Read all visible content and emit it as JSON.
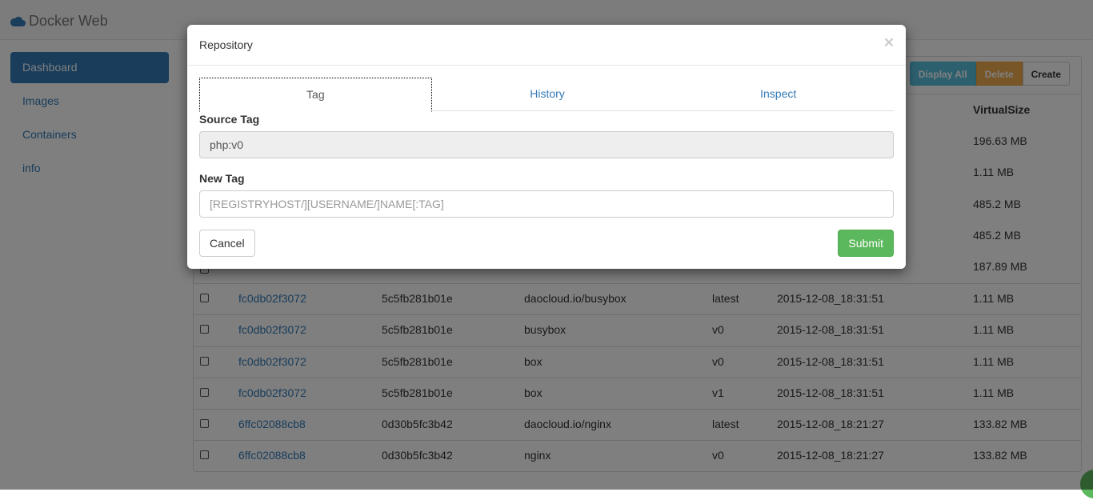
{
  "app": {
    "title": "Docker Web"
  },
  "sidebar": {
    "items": [
      {
        "label": "Dashboard",
        "active": true
      },
      {
        "label": "Images"
      },
      {
        "label": "Containers"
      },
      {
        "label": "info"
      }
    ]
  },
  "toolbar": {
    "display_all": "Display All",
    "delete": "Delete",
    "create": "Create"
  },
  "table": {
    "size_header": "VirtualSize",
    "upper_sizes": [
      "196.63 MB",
      "1.11 MB",
      "485.2 MB",
      "485.2 MB",
      "187.89 MB"
    ],
    "rows": [
      {
        "id": "fc0db02f3072",
        "parent": "5c5fb281b01e",
        "repo": "daocloud.io/busybox",
        "tag": "latest",
        "created": "2015-12-08_18:31:51",
        "size": "1.11 MB"
      },
      {
        "id": "fc0db02f3072",
        "parent": "5c5fb281b01e",
        "repo": "busybox",
        "tag": "v0",
        "created": "2015-12-08_18:31:51",
        "size": "1.11 MB"
      },
      {
        "id": "fc0db02f3072",
        "parent": "5c5fb281b01e",
        "repo": "box",
        "tag": "v0",
        "created": "2015-12-08_18:31:51",
        "size": "1.11 MB"
      },
      {
        "id": "fc0db02f3072",
        "parent": "5c5fb281b01e",
        "repo": "box",
        "tag": "v1",
        "created": "2015-12-08_18:31:51",
        "size": "1.11 MB"
      },
      {
        "id": "6ffc02088cb8",
        "parent": "0d30b5fc3b42",
        "repo": "daocloud.io/nginx",
        "tag": "latest",
        "created": "2015-12-08_18:21:27",
        "size": "133.82 MB"
      },
      {
        "id": "6ffc02088cb8",
        "parent": "0d30b5fc3b42",
        "repo": "nginx",
        "tag": "v0",
        "created": "2015-12-08_18:21:27",
        "size": "133.82 MB"
      }
    ]
  },
  "modal": {
    "title": "Repository",
    "close": "×",
    "tabs": [
      {
        "label": "Tag",
        "active": true
      },
      {
        "label": "History"
      },
      {
        "label": "Inspect"
      }
    ],
    "source_label": "Source Tag",
    "source_value": "php:v0",
    "new_label": "New Tag",
    "new_placeholder": "[REGISTRYHOST/][USERNAME/]NAME[:TAG]",
    "cancel": "Cancel",
    "submit": "Submit"
  },
  "colors": {
    "primary": "#337ab7",
    "success": "#5cb85c",
    "info": "#5bc0de",
    "warning": "#f0ad4e"
  }
}
